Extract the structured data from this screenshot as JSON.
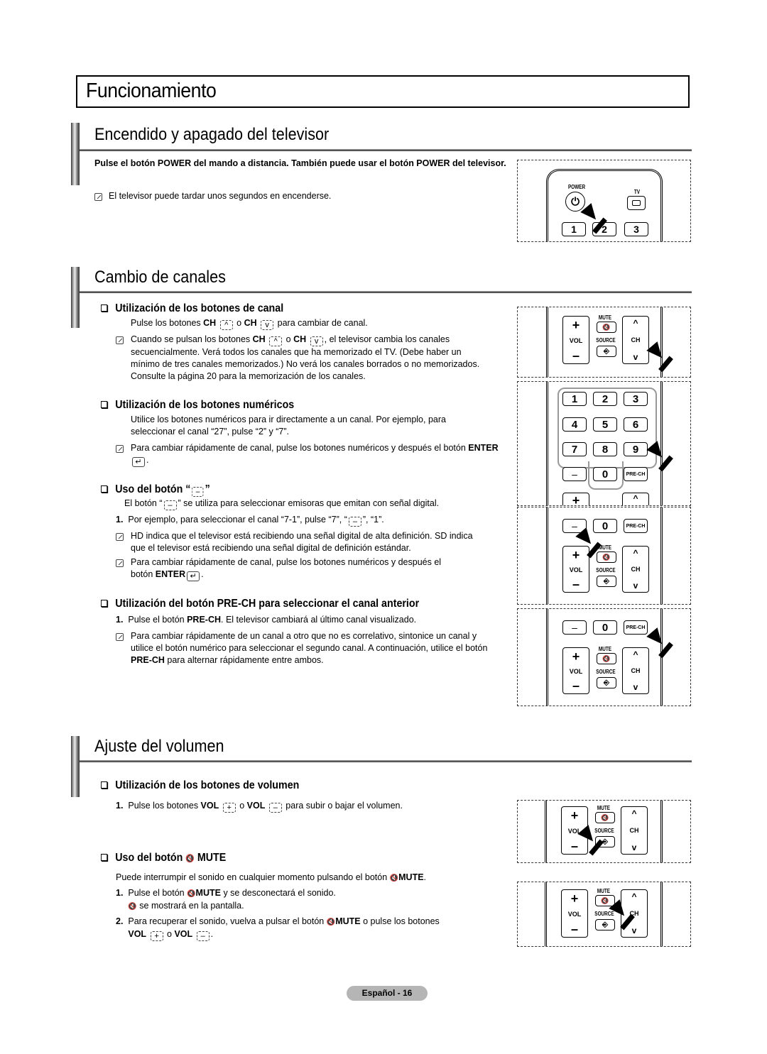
{
  "page_title": "Funcionamiento",
  "sections": {
    "power": {
      "title": "Encendido y apagado del televisor",
      "intro": "Pulse el botón POWER del mando a distancia. También puede usar el botón POWER del televisor.",
      "note": "El televisor puede tardar unos segundos en encenderse."
    },
    "channels": {
      "title": "Cambio de canales",
      "ch_buttons": {
        "title": "Utilización de los botones de canal",
        "line_a": "Pulse los botones ",
        "ch": "CH",
        "or": " o ",
        "line_b": " para cambiar de canal.",
        "note_a": "Cuando se pulsan los botones ",
        "note_b": ", el televisor cambia los canales",
        "note_rest": "secuencialmente. Verá todos los canales que ha memorizado el TV. (Debe haber un mínimo de tres canales memorizados.) No verá los canales borrados o no memorizados. Consulte la página 20 para la memorización de los canales."
      },
      "num_buttons": {
        "title": "Utilización de los botones numéricos",
        "text": "Utilice los botones numéricos para ir directamente a un canal. Por ejemplo, para seleccionar el canal “27”, pulse “2” y “7”.",
        "note": "Para cambiar rápidamente de canal, pulse los botones numéricos y después el botón",
        "enter": "ENTER"
      },
      "dash_button": {
        "title_a": "Uso del botón “",
        "title_b": "”",
        "text_a": "El botón “",
        "text_b": "” se utiliza para seleccionar emisoras que emitan con señal digital.",
        "step1_num": "1.",
        "step1_a": "Por ejemplo, para seleccionar el canal “7-1”, pulse “7”, “",
        "step1_b": "”, “1”.",
        "note1": "HD indica que el televisor está recibiendo una señal digital de alta definición. SD indica que el televisor está recibiendo una señal digital de definición estándar.",
        "note2_a": "Para cambiar rápidamente de canal, pulse los botones numéricos y después el",
        "note2_b": "botón ",
        "enter": "ENTER"
      },
      "prech": {
        "title": "Utilización del botón PRE-CH para seleccionar el canal anterior",
        "step1_num": "1.",
        "step1_a": "Pulse el botón ",
        "prech": "PRE-CH",
        "step1_b": ". El televisor cambiará al último canal visualizado.",
        "note_a": "Para cambiar rápidamente de un canal a otro que no es correlativo, sintonice un canal y utilice el botón numérico para seleccionar el segundo canal. A continuación, utilice el botón ",
        "note_b": " para alternar rápidamente entre ambos."
      }
    },
    "volume": {
      "title": "Ajuste del volumen",
      "vol_buttons": {
        "title": "Utilización de los botones de volumen",
        "step1_num": "1.",
        "step1_a": "Pulse los botones ",
        "vol": "VOL",
        "or": " o ",
        "step1_b": " para subir o bajar el volumen."
      },
      "mute": {
        "title_a": "Uso del botón ",
        "title_b": " MUTE",
        "text_a": "Puede interrumpir el sonido en cualquier momento pulsando el botón ",
        "mute": "MUTE",
        "step1_num": "1.",
        "step1_a": "Pulse el botón ",
        "step1_b": " y se desconectará el sonido.",
        "step1_c": " se mostrará en la pantalla.",
        "step2_num": "2.",
        "step2_a": "Para recuperar el sonido, vuelva a pulsar el botón ",
        "step2_b": " o pulse los botones",
        "vol": "VOL",
        "or": " o "
      }
    }
  },
  "remote": {
    "power": "POWER",
    "tv": "TV",
    "mute": "MUTE",
    "source": "SOURCE",
    "vol": "VOL",
    "ch": "CH",
    "prech": "PRE-CH",
    "digits": [
      "1",
      "2",
      "3",
      "4",
      "5",
      "6",
      "7",
      "8",
      "9"
    ],
    "zero": "0",
    "dash": "–",
    "plus": "+",
    "minus": "–"
  },
  "icons": {
    "up": "^",
    "down": "v",
    "mute_glyph": "🔇",
    "enter": "↵",
    "power": "⏻",
    "source": "⎆"
  },
  "footer": "Español - 16"
}
